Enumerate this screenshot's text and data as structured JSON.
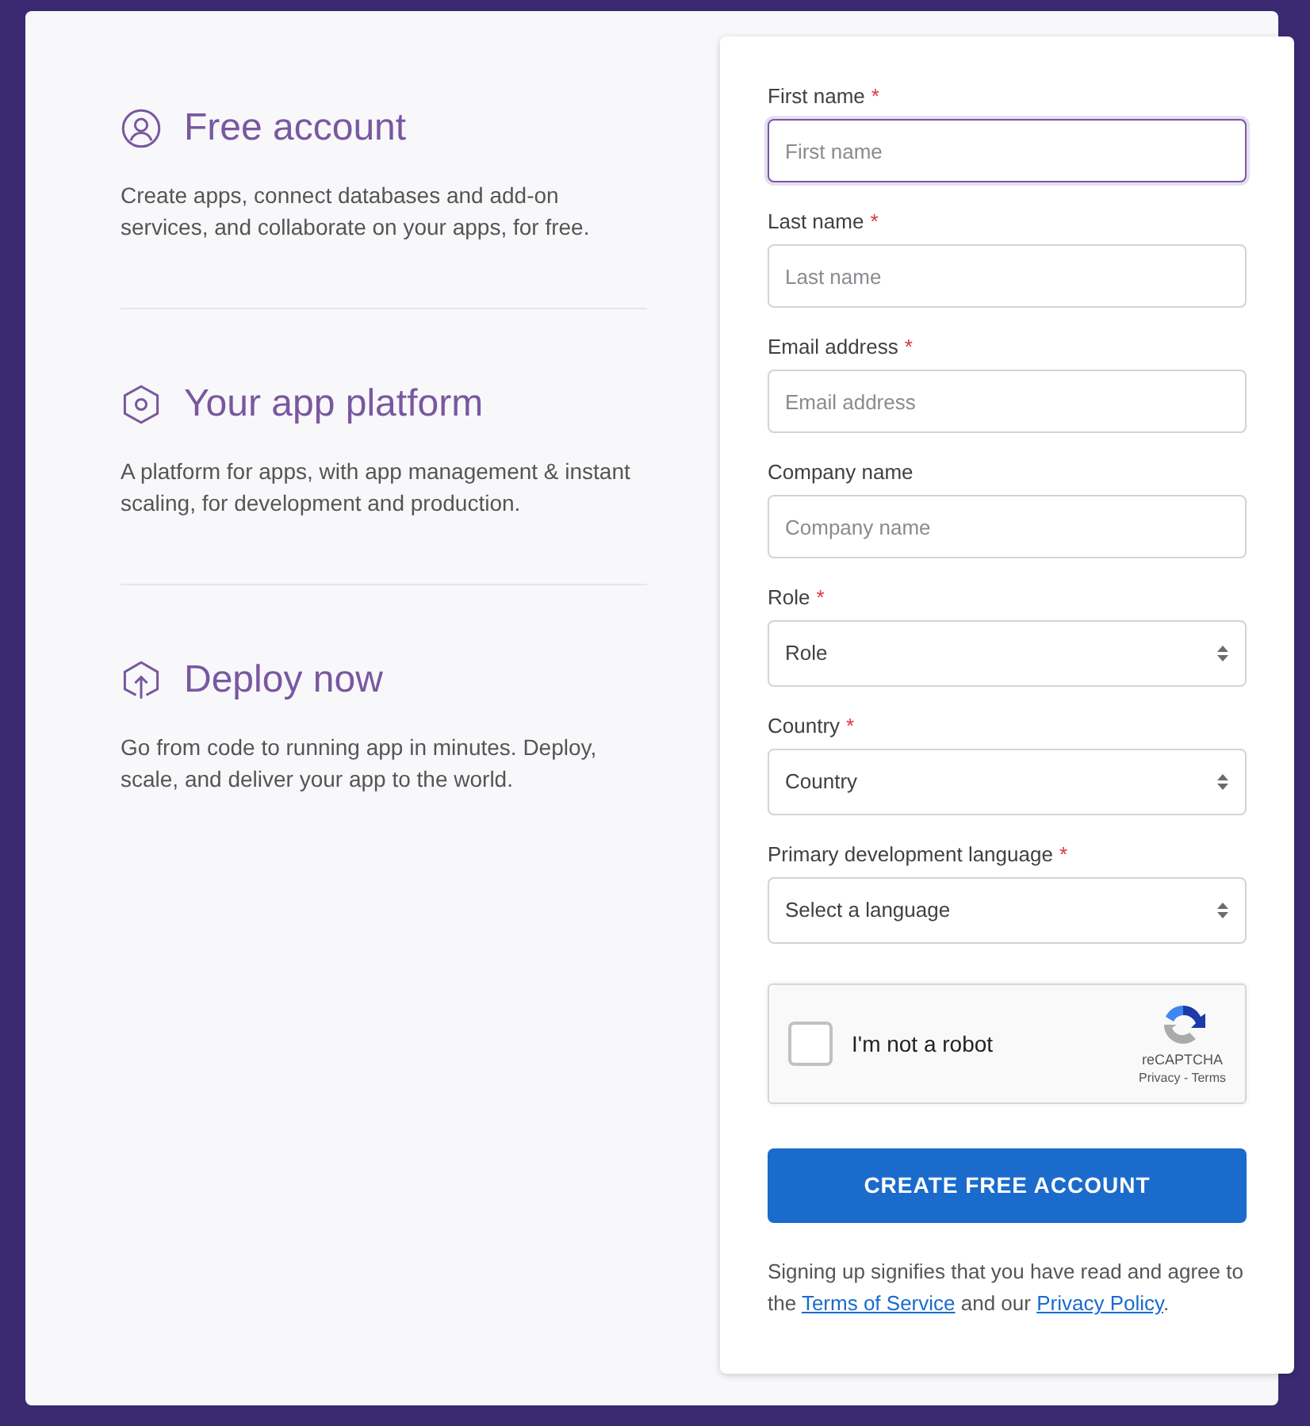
{
  "features": [
    {
      "kind": "user",
      "title": "Free account",
      "text": "Create apps, connect databases and add-on services, and collaborate on your apps, for free."
    },
    {
      "kind": "hexagon",
      "title": "Your app platform",
      "text": "A platform for apps, with app management & instant scaling, for development and production."
    },
    {
      "kind": "upload",
      "title": "Deploy now",
      "text": "Go from code to running app in minutes. Deploy, scale, and deliver your app to the world."
    }
  ],
  "form": {
    "fields": [
      {
        "kind": "text",
        "label": "First name",
        "required_mark": "*",
        "placeholder": "First name",
        "focused": true
      },
      {
        "kind": "text",
        "label": "Last name",
        "required_mark": "*",
        "placeholder": "Last name",
        "focused": false
      },
      {
        "kind": "text",
        "label": "Email address",
        "required_mark": "*",
        "placeholder": "Email address",
        "focused": false
      },
      {
        "kind": "text",
        "label": "Company name",
        "placeholder": "Company name",
        "focused": false
      },
      {
        "kind": "select",
        "label": "Role",
        "required_mark": "*",
        "value": "Role",
        "focused": false
      },
      {
        "kind": "select",
        "label": "Country",
        "required_mark": "*",
        "value": "Country",
        "focused": false
      },
      {
        "kind": "select",
        "label": "Primary development language",
        "required_mark": "*",
        "value": "Select a language",
        "focused": false
      }
    ],
    "captcha": {
      "label": "I'm not a robot",
      "checked": false,
      "brand": "reCAPTCHA",
      "links": "Privacy - Terms"
    },
    "submit": "CREATE FREE ACCOUNT",
    "terms": {
      "before": "Signing up signifies that you have read and agree to the ",
      "link1": "Terms of Service",
      "middle": " and our ",
      "link2": "Privacy Policy",
      "after": "."
    }
  }
}
